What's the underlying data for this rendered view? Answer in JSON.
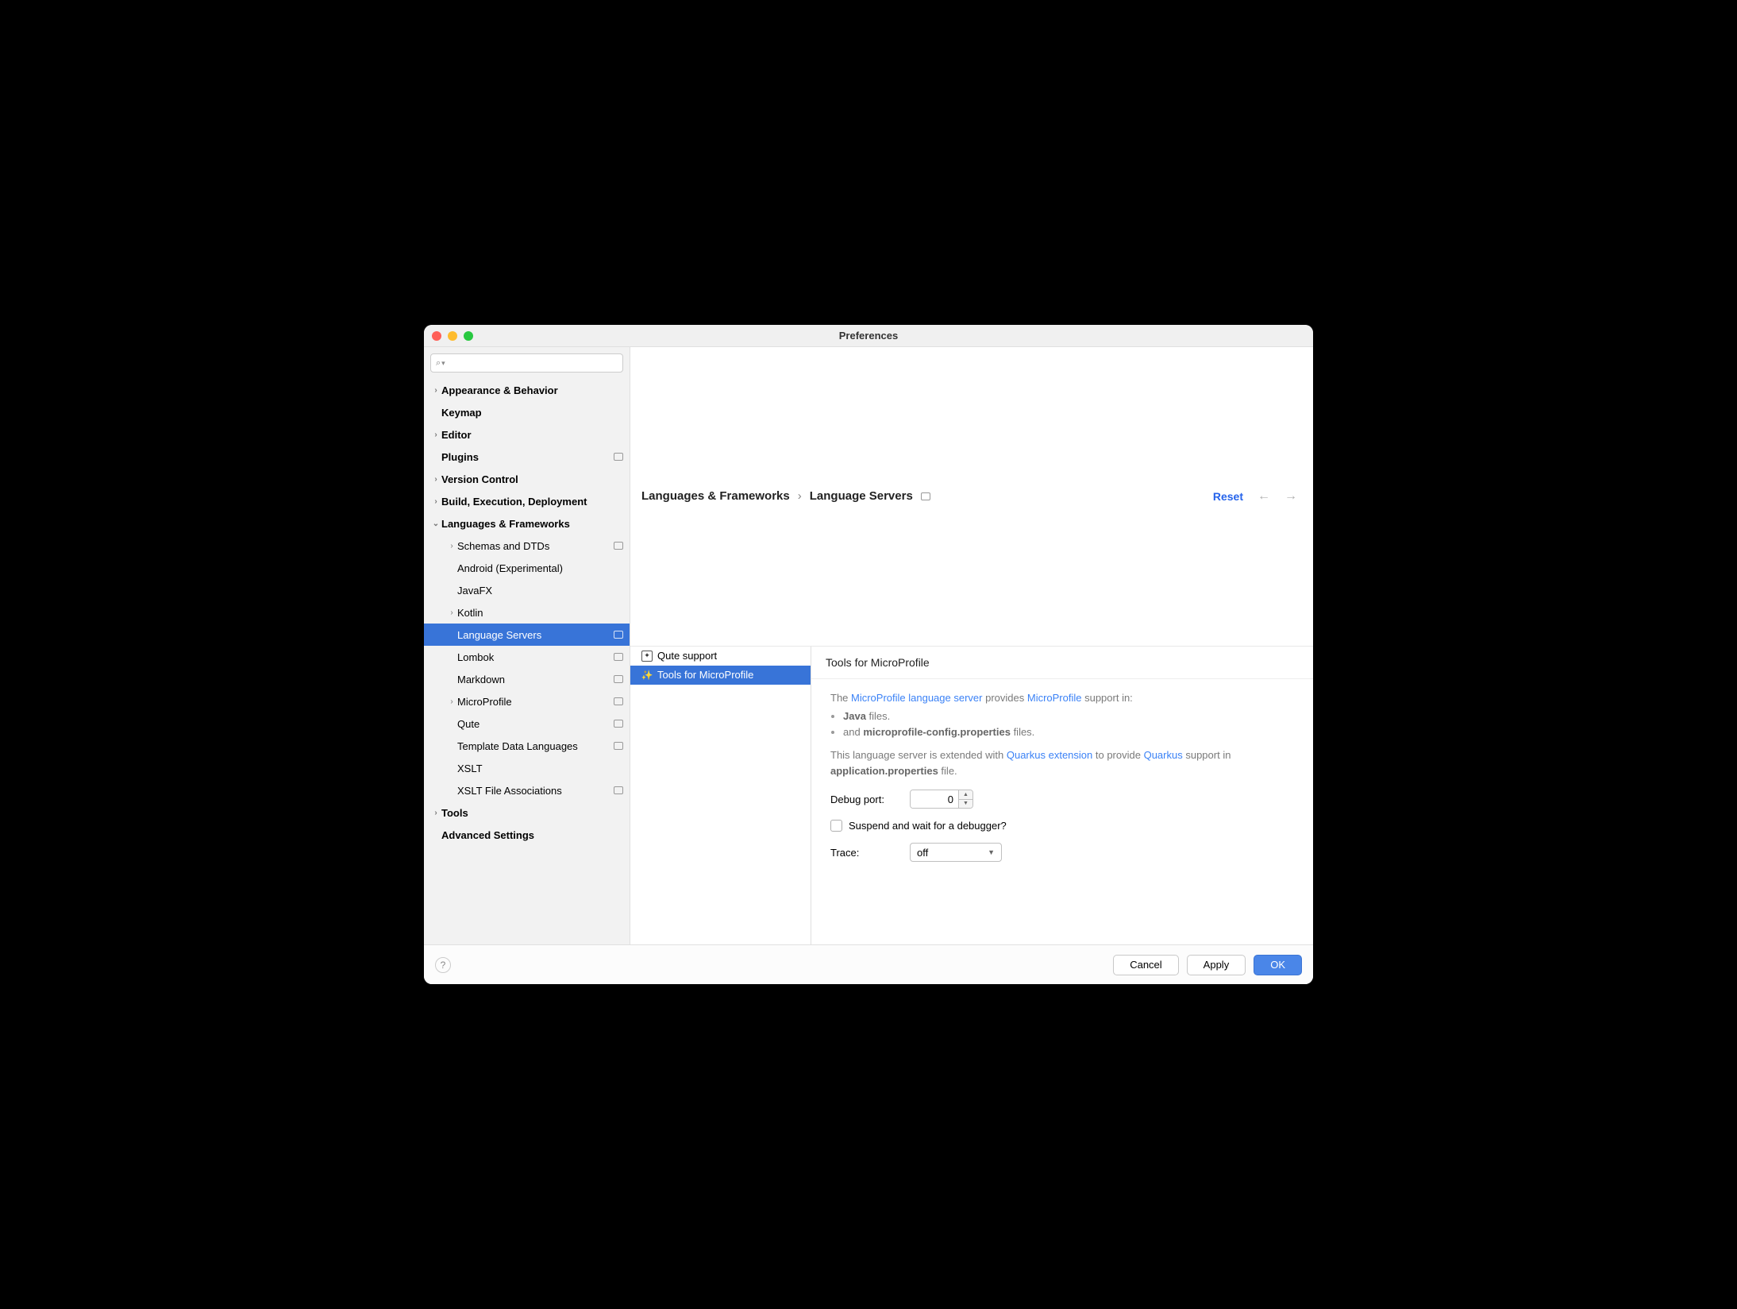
{
  "window": {
    "title": "Preferences"
  },
  "search": {
    "placeholder": ""
  },
  "sidebar": {
    "items": [
      {
        "label": "Appearance & Behavior",
        "top": true,
        "arrow": ">"
      },
      {
        "label": "Keymap",
        "top": true
      },
      {
        "label": "Editor",
        "top": true,
        "arrow": ">"
      },
      {
        "label": "Plugins",
        "top": true,
        "badge": true
      },
      {
        "label": "Version Control",
        "top": true,
        "arrow": ">"
      },
      {
        "label": "Build, Execution, Deployment",
        "top": true,
        "arrow": ">"
      },
      {
        "label": "Languages & Frameworks",
        "top": true,
        "arrow": "v",
        "expanded": true
      },
      {
        "label": "Schemas and DTDs",
        "child": true,
        "arrow": ">",
        "badge": true
      },
      {
        "label": "Android (Experimental)",
        "child": true
      },
      {
        "label": "JavaFX",
        "child": true
      },
      {
        "label": "Kotlin",
        "child": true,
        "arrow": ">"
      },
      {
        "label": "Language Servers",
        "child": true,
        "badge": true,
        "selected": true
      },
      {
        "label": "Lombok",
        "child": true,
        "badge": true
      },
      {
        "label": "Markdown",
        "child": true,
        "badge": true
      },
      {
        "label": "MicroProfile",
        "child": true,
        "arrow": ">",
        "badge": true
      },
      {
        "label": "Qute",
        "child": true,
        "badge": true
      },
      {
        "label": "Template Data Languages",
        "child": true,
        "badge": true
      },
      {
        "label": "XSLT",
        "child": true
      },
      {
        "label": "XSLT File Associations",
        "child": true,
        "badge": true
      },
      {
        "label": "Tools",
        "top": true,
        "arrow": ">"
      },
      {
        "label": "Advanced Settings",
        "top": true
      }
    ]
  },
  "breadcrumb": {
    "parent": "Languages & Frameworks",
    "current": "Language Servers"
  },
  "reset_label": "Reset",
  "servers": [
    {
      "label": "Qute support",
      "icon": "qute"
    },
    {
      "label": "Tools for MicroProfile",
      "icon": "sparkle",
      "selected": true
    }
  ],
  "panel": {
    "title": "Tools for MicroProfile",
    "desc_parts": {
      "p1_the": "The ",
      "p1_link1": "MicroProfile language server",
      "p1_mid": " provides ",
      "p1_link2": "MicroProfile",
      "p1_end": " support in:",
      "li1_strong": "Java",
      "li1_rest": " files.",
      "li2_pre": "and ",
      "li2_strong": "microprofile-config.properties",
      "li2_rest": " files.",
      "p2_pre": "This language server is extended with ",
      "p2_link1": "Quarkus extension",
      "p2_mid": " to provide ",
      "p2_link2": "Quarkus",
      "p2_mid2": " support in ",
      "p2_strong": "application.properties",
      "p2_end": " file."
    },
    "debug_label": "Debug port:",
    "debug_value": "0",
    "suspend_label": "Suspend and wait for a debugger?",
    "trace_label": "Trace:",
    "trace_value": "off"
  },
  "footer": {
    "cancel": "Cancel",
    "apply": "Apply",
    "ok": "OK"
  }
}
